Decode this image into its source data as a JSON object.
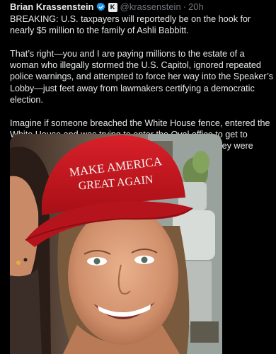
{
  "tweet": {
    "author": {
      "display_name": "Brian Krassenstein",
      "handle": "@krassenstein",
      "verified_icon": "verified-badge-icon",
      "affiliation_badge": "K"
    },
    "separator": "·",
    "time": "20h",
    "paragraphs": [
      "BREAKING: U.S. taxpayers will reportedly be on the hook for nearly $5 million to the family of Ashli Babbitt.",
      "That’s right—you and I are paying millions to the estate of a woman who illegally stormed the U.S. Capitol, ignored repeated police warnings, and attempted to force her way into the Speaker’s Lobby—just feet away from lawmakers certifying a democratic election.",
      "Imagine if someone breached the White House fence, entered the White House and was trying to enter the Oval office to get to Trump.  Would you want their family compensated if they were killed by Secret Service?"
    ],
    "media": {
      "hat_line_1": "MAKE AMERICA",
      "hat_line_2": "GREAT AGAIN"
    }
  },
  "colors": {
    "background": "#000000",
    "text_primary": "#e7e9ea",
    "text_secondary": "#71767b",
    "verified": "#1d9bf0",
    "hat_red": "#c8141c"
  }
}
